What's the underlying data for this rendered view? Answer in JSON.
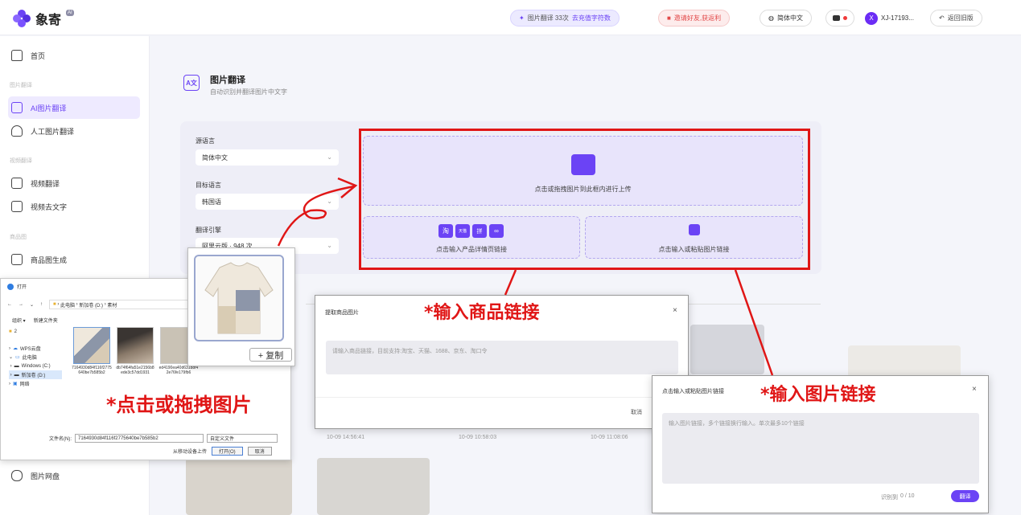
{
  "header": {
    "brand": "象寄",
    "brand_badge": "AI",
    "quota_text": "图片翻译 33次",
    "quota_link": "去充值字符数",
    "invite": "邀请好友,获返利",
    "language": "简体中文",
    "avatar_letter": "X",
    "user_name": "XJ-17193...",
    "back_old": "返回旧版"
  },
  "sidebar": {
    "home": "首页",
    "group_image": "图片翻译",
    "ai_translate": "AI图片翻译",
    "manual_translate": "人工图片翻译",
    "group_video": "视频翻译",
    "video_translate": "视频翻译",
    "video_remove_text": "视频去文字",
    "group_product": "商品图",
    "product_generate": "商品图生成",
    "image_drive": "图片网盘"
  },
  "page": {
    "title": "图片翻译",
    "subtitle": "自动识别并翻译图片中文字"
  },
  "form": {
    "source_label": "源语言",
    "source_value": "简体中文",
    "target_label": "目标语言",
    "target_value": "韩国语",
    "engine_label": "翻译引擎",
    "engine_value": "阿里云版 · 948 次"
  },
  "upload": {
    "main_text": "点击或拖拽图片到此框内进行上传",
    "product_link_text": "点击输入产品详情页链接",
    "paste_link_text": "点击输入或粘贴图片链接",
    "platform_icons": [
      "淘",
      "天猫",
      "拼",
      "∞"
    ]
  },
  "timestamps": [
    "10-09 14:56:41",
    "10-09 10:58:03",
    "10-09 11:08:06"
  ],
  "file_dialog": {
    "title": "打开",
    "path": [
      "此电脑",
      "新加卷 (D:)",
      "素材"
    ],
    "organize": "组织 ▾",
    "new_folder": "新建文件夹",
    "tree": [
      "2",
      "WPS云盘",
      "此电脑",
      "Windows (C:)",
      "新加卷 (D:)",
      "网络"
    ],
    "files": [
      {
        "name": "7164930d84f116f2775640be7b585b2"
      },
      {
        "name": "db74f64fa51e2156b8ede3c57dd1931"
      },
      {
        "name": "ed4190ea40d631b8f42e76fe179fb6"
      }
    ],
    "filename_label": "文件名(N):",
    "filename_value": "7164930d84f116f2775640be7b585b2",
    "filter": "自定义文件",
    "upload_from_device": "从移动设备上传",
    "open": "打开(O)",
    "cancel": "取消"
  },
  "preview": {
    "copy_button": "+ 复制"
  },
  "product_link_dialog": {
    "title": "提取商品图片",
    "placeholder": "请输入商品链接，目前支持:淘宝、天猫、1688、京东、淘口令",
    "cancel": "取消",
    "close": "×"
  },
  "image_link_dialog": {
    "title": "点击输入或粘贴图片链接",
    "placeholder": "输入图片链接，多个链接换行输入。单次最多10个链接",
    "counter_label": "识别到",
    "counter": "0 / 10",
    "translate": "翻译",
    "close": "×"
  },
  "annotations": {
    "product_link": "*输入商品链接",
    "image_link": "*输入图片链接",
    "drag_image": "*点击或拖拽图片"
  },
  "colors": {
    "accent": "#6b43f5",
    "annotation_red": "#e01616",
    "panel_bg": "#eeeef7"
  }
}
